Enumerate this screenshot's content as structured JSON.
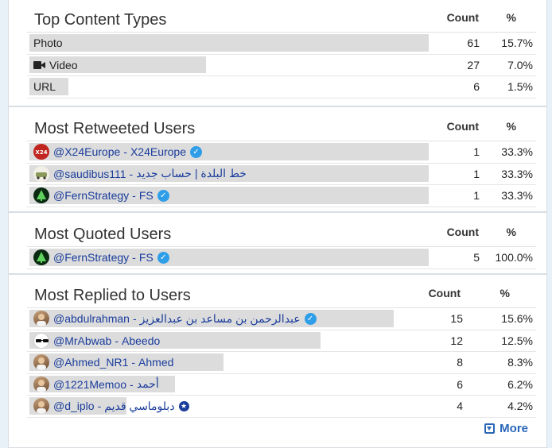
{
  "sections": [
    {
      "title": "Top Content Types",
      "count_label": "Count",
      "pct_label": "%",
      "rows": [
        {
          "label": "Photo",
          "icon": null,
          "count": "61",
          "pct": "15.7%",
          "bar_fraction": 1.0
        },
        {
          "label": "Video",
          "icon": "video-camera-icon",
          "count": "27",
          "pct": "7.0%",
          "bar_fraction": 0.443
        },
        {
          "label": "URL",
          "icon": null,
          "count": "6",
          "pct": "1.5%",
          "bar_fraction": 0.098
        }
      ]
    },
    {
      "title": "Most Retweeted Users",
      "count_label": "Count",
      "pct_label": "%",
      "rows": [
        {
          "handle": "@X24Europe",
          "name": "X24Europe",
          "avatar": "x24-avatar",
          "badge": "verified",
          "count": "1",
          "pct": "33.3%",
          "bar_fraction": 1.0
        },
        {
          "handle": "@saudibus111",
          "name": "خط البلدة | حساب جديد",
          "avatar": "bus-avatar",
          "badge": null,
          "count": "1",
          "pct": "33.3%",
          "bar_fraction": 1.0
        },
        {
          "handle": "@FernStrategy",
          "name": "FS",
          "avatar": "tree-avatar",
          "badge": "verified",
          "count": "1",
          "pct": "33.3%",
          "bar_fraction": 1.0
        }
      ]
    },
    {
      "title": "Most Quoted Users",
      "count_label": "Count",
      "pct_label": "%",
      "rows": [
        {
          "handle": "@FernStrategy",
          "name": "FS",
          "avatar": "tree-avatar",
          "badge": "verified",
          "count": "5",
          "pct": "100.0%",
          "bar_fraction": 1.0
        }
      ]
    },
    {
      "title": "Most Replied to Users",
      "count_label": "Count",
      "pct_label": "%",
      "rows": [
        {
          "handle": "@abdulrahman",
          "name": "عبدالرحمن بن مساعد بن عبدالعزيز",
          "avatar": "photo-avatar",
          "badge": "verified",
          "count": "15",
          "pct": "15.6%",
          "bar_fraction": 1.0
        },
        {
          "handle": "@MrAbwab",
          "name": "Abeedo",
          "avatar": "sunglasses-avatar",
          "badge": null,
          "count": "12",
          "pct": "12.5%",
          "bar_fraction": 0.8
        },
        {
          "handle": "@Ahmed_NR1",
          "name": "Ahmed",
          "avatar": "photo-avatar",
          "badge": null,
          "count": "8",
          "pct": "8.3%",
          "bar_fraction": 0.533
        },
        {
          "handle": "@1221Memoo",
          "name": "أحمد",
          "avatar": "photo-avatar",
          "badge": null,
          "count": "6",
          "pct": "6.2%",
          "bar_fraction": 0.4
        },
        {
          "handle": "@d_iplo",
          "name": "دبلوماسي قديم",
          "avatar": "photo-avatar",
          "badge": "star",
          "count": "4",
          "pct": "4.2%",
          "bar_fraction": 0.267
        }
      ]
    }
  ],
  "separator": " - ",
  "more_label": "More",
  "colors": {
    "page_bg": "#e8f1f8",
    "bar": "#dcdcdc",
    "link": "#1a3d9c",
    "verified": "#2f9ee9",
    "more": "#2a66b8"
  }
}
